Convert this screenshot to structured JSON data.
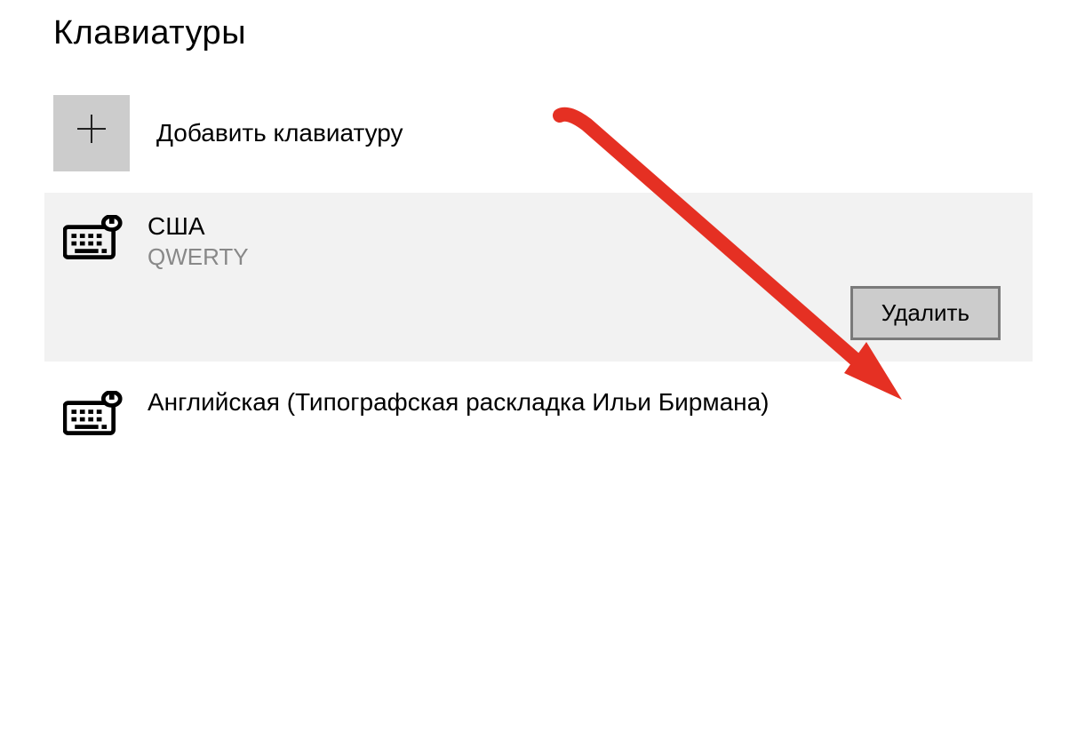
{
  "section": {
    "title": "Клавиатуры"
  },
  "add": {
    "label": "Добавить клавиатуру"
  },
  "keyboards": [
    {
      "name": "США",
      "layout": "QWERTY",
      "selected": true,
      "delete_label": "Удалить"
    },
    {
      "name": "Английская (Типографская раскладка Ильи Бирмана)",
      "layout": "",
      "selected": false
    }
  ],
  "annotation": {
    "arrow_color": "#e53023"
  }
}
